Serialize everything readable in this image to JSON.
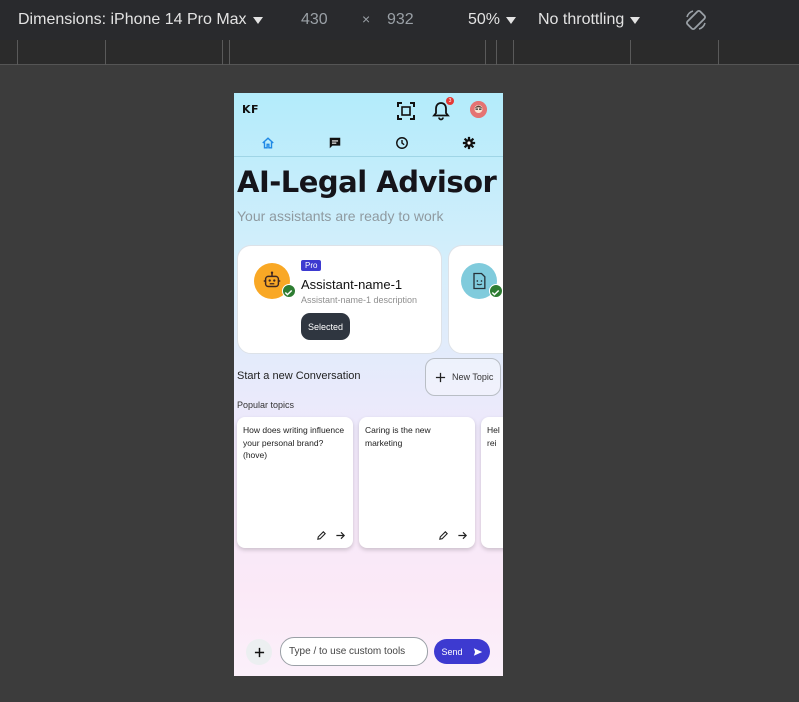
{
  "devtools": {
    "dimensions_label": "Dimensions: iPhone 14 Pro Max",
    "width": "430",
    "times": "×",
    "height": "932",
    "zoom": "50%",
    "throttling": "No throttling"
  },
  "app": {
    "logo": "KF",
    "notification_count": "3",
    "title": "AI-Legal Advisor",
    "subtitle": "Your assistants are ready to work",
    "assistants": [
      {
        "tier": "Pro",
        "name": "Assistant-name-1",
        "description": "Assistant-name-1 description",
        "status": "Selected"
      }
    ],
    "start_label": "Start a new Conversation",
    "new_topic_label": "New Topic",
    "popular_label": "Popular topics",
    "topics": [
      {
        "text": "How does writing influence your personal brand? (hove)"
      },
      {
        "text": "Caring is the new marketing"
      },
      {
        "text": "Hel rei"
      }
    ],
    "composer": {
      "placeholder": "Type / to use custom tools",
      "send_label": "Send"
    }
  },
  "colors": {
    "accent": "#3d3ad0",
    "home_active": "#1e88e5",
    "check": "#2e7d32",
    "badge": "#e53935"
  }
}
